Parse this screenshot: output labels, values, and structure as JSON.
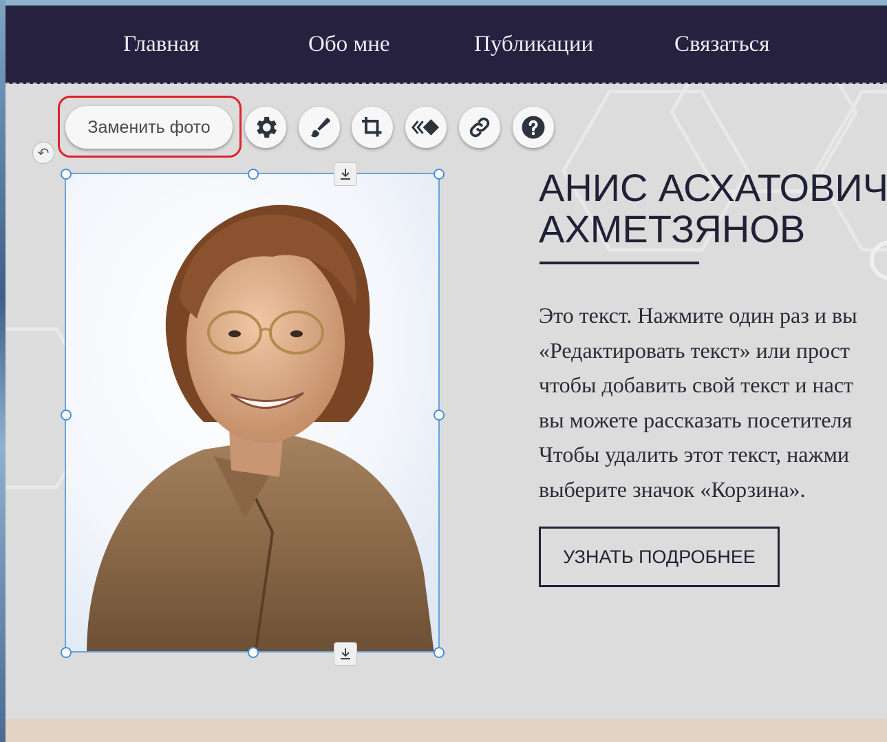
{
  "nav": {
    "items": [
      {
        "label": "Главная"
      },
      {
        "label": "Обо мне"
      },
      {
        "label": "Публикации"
      },
      {
        "label": "Связаться"
      }
    ]
  },
  "toolbar": {
    "replace_photo_label": "Заменить фото",
    "icons": [
      "gear-icon",
      "brush-icon",
      "crop-icon",
      "animation-icon",
      "link-icon",
      "help-icon"
    ],
    "highlight_color": "#e0202a"
  },
  "hero": {
    "name_line1": "АНИС АСХАТОВИЧ",
    "name_line2": "АХМЕТЗЯНОВ",
    "paragraph": "Это текст. Нажмите один раз и вы\n«Редактировать текст» или прост\nчтобы добавить свой текст и наст\nвы можете рассказать посетителя\nЧтобы удалить этот текст, нажми\nвыберите значок «Корзина».",
    "cta_label": "УЗНАТЬ ПОДРОБНЕЕ"
  },
  "colors": {
    "nav_bg": "#25213f",
    "accent_dark": "#222036",
    "selection_blue": "#4a90d9",
    "page_bg": "#dcdcdc"
  }
}
